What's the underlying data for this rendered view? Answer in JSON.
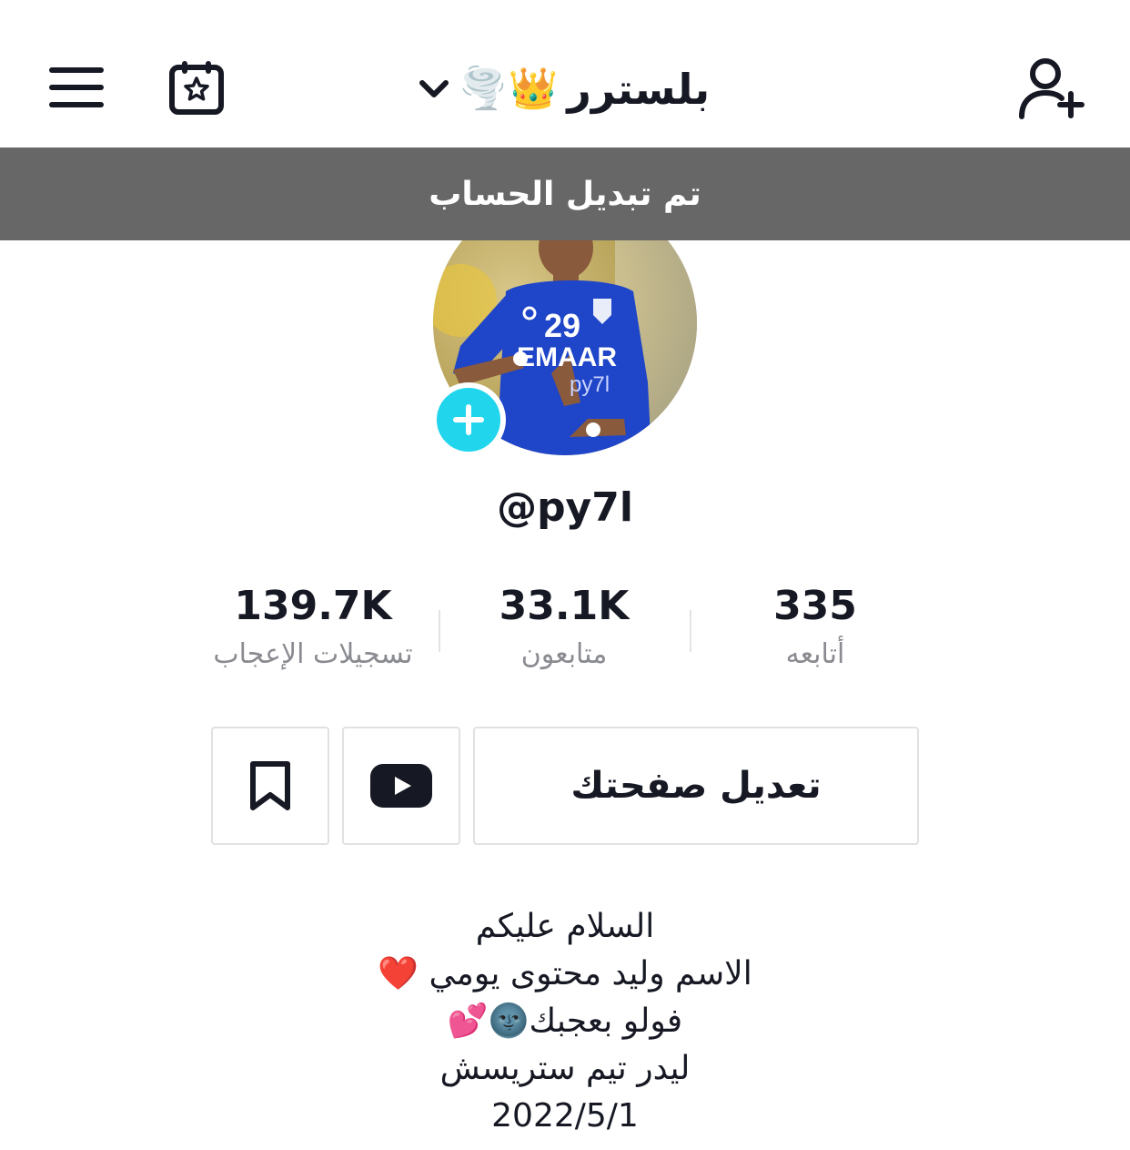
{
  "header": {
    "title": "بلسترر",
    "title_emojis": "🌪️👑",
    "dropdown_icon": "chevron-down-icon",
    "left_icons": [
      "menu-icon",
      "calendar-star-icon"
    ],
    "right_icon": "add-user-icon"
  },
  "toast": {
    "text": "تم تبديل الحساب"
  },
  "profile": {
    "username": "@py7l",
    "avatar_jersey_number": "29",
    "avatar_jersey_text": "EMAAR",
    "avatar_watermark": "py7l"
  },
  "stats": [
    {
      "value": "335",
      "label": "أتابعه"
    },
    {
      "value": "33.1K",
      "label": "متابعون"
    },
    {
      "value": "139.7K",
      "label": "تسجيلات الإعجاب"
    }
  ],
  "buttons": {
    "edit_profile": "تعديل صفحتك",
    "youtube_icon": "youtube-icon",
    "bookmark_icon": "bookmark-icon"
  },
  "bio": {
    "line1": "السلام عليكم",
    "line2": "الاسم وليد محتوى يومي ❤️",
    "line3": "فولو بعجبك🌚💕",
    "line4": "ليدر تيم ستريسش",
    "line5": "2022/5/1"
  },
  "colors": {
    "toast_bg": "#676767",
    "add_badge": "#20d5ec",
    "jersey_blue": "#1f45c8",
    "label_gray": "#8a8b91"
  }
}
